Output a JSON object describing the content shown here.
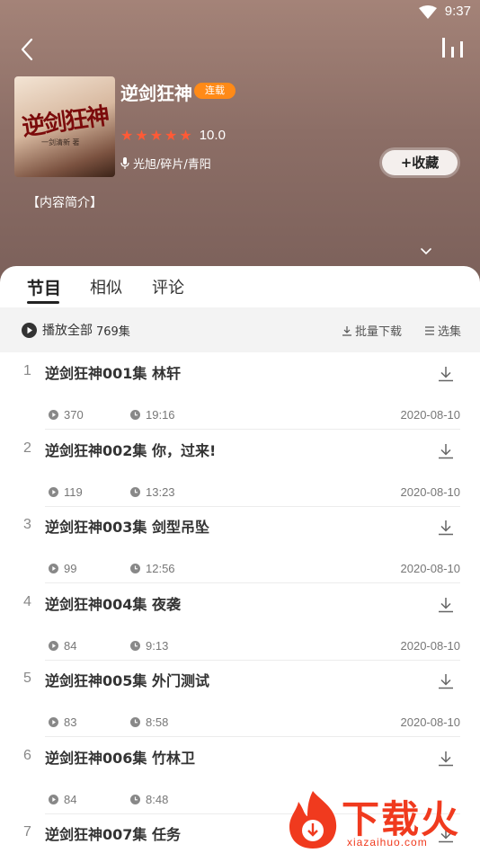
{
  "status_bar": {
    "time": "9:37"
  },
  "album": {
    "title": "逆剑狂神",
    "badge": "连载",
    "cover_title": "逆剑狂神",
    "cover_subtitle": "一剑清新 著",
    "rating": 10.0,
    "rating_text": "10.0",
    "stars": 5,
    "author": "光旭/碎片/青阳",
    "favorite_label": "+收藏",
    "intro_label": "【内容简介】"
  },
  "tabs": [
    {
      "label": "节目",
      "active": true
    },
    {
      "label": "相似",
      "active": false
    },
    {
      "label": "评论",
      "active": false
    }
  ],
  "playbar": {
    "play_all_label": "播放全部",
    "count": "769集",
    "batch_download_label": "批量下载",
    "select_label": "选集"
  },
  "episodes": [
    {
      "num": "1",
      "title": "逆剑狂神001集 林轩",
      "plays": "370",
      "duration": "19:16",
      "date": "2020-08-10"
    },
    {
      "num": "2",
      "title": "逆剑狂神002集 你，过来!",
      "plays": "119",
      "duration": "13:23",
      "date": "2020-08-10"
    },
    {
      "num": "3",
      "title": "逆剑狂神003集 剑型吊坠",
      "plays": "99",
      "duration": "12:56",
      "date": "2020-08-10"
    },
    {
      "num": "4",
      "title": "逆剑狂神004集 夜袭",
      "plays": "84",
      "duration": "9:13",
      "date": "2020-08-10"
    },
    {
      "num": "5",
      "title": "逆剑狂神005集 外门测试",
      "plays": "83",
      "duration": "8:58",
      "date": "2020-08-10"
    },
    {
      "num": "6",
      "title": "逆剑狂神006集 竹林卫",
      "plays": "84",
      "duration": "8:48",
      "date": ""
    },
    {
      "num": "7",
      "title": "逆剑狂神007集 任务",
      "plays": "",
      "duration": "",
      "date": ""
    }
  ],
  "watermark": {
    "text": "下载火",
    "subtext": "xiazaihuo.com"
  },
  "colors": {
    "accent": "#ff8a17",
    "star": "#ff5a36",
    "watermark": "#f03a1e"
  }
}
